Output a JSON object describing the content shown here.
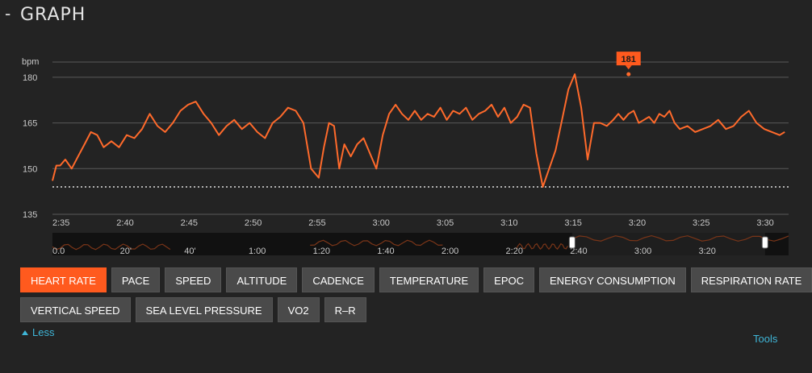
{
  "header": {
    "collapse_symbol": "-",
    "title": "GRAPH"
  },
  "chart_data": {
    "type": "line",
    "ylabel": "bpm",
    "ylim": [
      135,
      185
    ],
    "yticks": [
      135,
      150,
      165,
      180
    ],
    "reference_line": 144,
    "series": [
      {
        "color": "#ff6a2b",
        "x_minutes": [
          155,
          155.3,
          155.6,
          156,
          156.5,
          157,
          157.5,
          158,
          158.5,
          159,
          159.6,
          160.2,
          160.8,
          161.4,
          162,
          162.6,
          163.2,
          163.8,
          164.4,
          165,
          165.6,
          166.2,
          166.8,
          167.4,
          168,
          168.6,
          169.2,
          169.8,
          170.4,
          171,
          171.6,
          172.2,
          172.8,
          173.4,
          174,
          174.6,
          175.2,
          175.8,
          176.2,
          176.6,
          177,
          177.4,
          177.8,
          178.3,
          178.8,
          179.3,
          179.8,
          180.3,
          180.8,
          181.3,
          181.8,
          182.3,
          182.8,
          183.3,
          183.8,
          184.3,
          184.8,
          185.3,
          185.8,
          186.3,
          186.8,
          187.3,
          187.8,
          188.3,
          188.8,
          189.3,
          189.8,
          190.3,
          190.8,
          191.3,
          191.8,
          192.3,
          192.8,
          193.3,
          193.8,
          194.3,
          194.8,
          195.3,
          195.8,
          196.3,
          196.8,
          197.3,
          197.8,
          198.3,
          198.8,
          199.2,
          199.6,
          200,
          200.4,
          200.8,
          201.2,
          201.6,
          202,
          202.4,
          202.8,
          203.2,
          203.6,
          204,
          204.6,
          205.2,
          205.8,
          206.4,
          207,
          207.6,
          208.2,
          208.8,
          209.4,
          210,
          210.6,
          211.2,
          211.8,
          212.2
        ],
        "values": [
          146,
          151,
          151,
          153,
          150,
          154,
          158,
          162,
          161,
          157,
          159,
          157,
          161,
          160,
          163,
          168,
          164,
          162,
          165,
          169,
          171,
          172,
          168,
          165,
          161,
          164,
          166,
          163,
          165,
          162,
          160,
          165,
          167,
          170,
          169,
          165,
          150,
          147,
          157,
          165,
          164,
          150,
          158,
          154,
          158,
          160,
          155,
          150,
          161,
          168,
          171,
          168,
          166,
          169,
          166,
          168,
          167,
          170,
          166,
          169,
          168,
          170,
          166,
          168,
          169,
          171,
          167,
          170,
          165,
          167,
          171,
          170,
          155,
          144,
          150,
          156,
          166,
          176,
          181,
          170,
          153,
          165,
          165,
          164,
          166,
          168,
          166,
          168,
          169,
          165,
          166,
          167,
          165,
          168,
          167,
          169,
          165,
          163,
          164,
          162,
          163,
          164,
          166,
          163,
          164,
          167,
          169,
          165,
          163,
          162,
          161,
          162
        ]
      }
    ],
    "max_marker": {
      "label": "181",
      "x_minutes": 200,
      "value": 181
    },
    "x_tick_labels": [
      "2:35",
      "2:40",
      "2:45",
      "2:50",
      "2:55",
      "3:00",
      "3:05",
      "3:10",
      "3:15",
      "3:20",
      "3:25",
      "3:30"
    ],
    "overview": {
      "tick_labels": [
        "0.0",
        "20'",
        "40'",
        "1:00",
        "1:20",
        "1:40",
        "2:00",
        "2:20",
        "2:40",
        "3:00",
        "3:20"
      ],
      "selection_start_fraction": 0.706,
      "selection_end_fraction": 0.968
    }
  },
  "buttons_row1": [
    {
      "label": "HEART RATE",
      "active": true
    },
    {
      "label": "PACE",
      "active": false
    },
    {
      "label": "SPEED",
      "active": false
    },
    {
      "label": "ALTITUDE",
      "active": false
    },
    {
      "label": "CADENCE",
      "active": false
    },
    {
      "label": "TEMPERATURE",
      "active": false
    },
    {
      "label": "EPOC",
      "active": false
    },
    {
      "label": "ENERGY CONSUMPTION",
      "active": false
    },
    {
      "label": "RESPIRATION RATE",
      "active": false
    }
  ],
  "buttons_row2": [
    {
      "label": "VERTICAL SPEED",
      "active": false
    },
    {
      "label": "SEA LEVEL PRESSURE",
      "active": false
    },
    {
      "label": "VO2",
      "active": false
    },
    {
      "label": "R–R",
      "active": false
    }
  ],
  "footer": {
    "less_label": "Less",
    "tools_label": "Tools"
  },
  "colors": {
    "accent": "#ff5a1e",
    "line": "#ff6a2b",
    "link": "#3fb6d8",
    "background": "#232323"
  }
}
